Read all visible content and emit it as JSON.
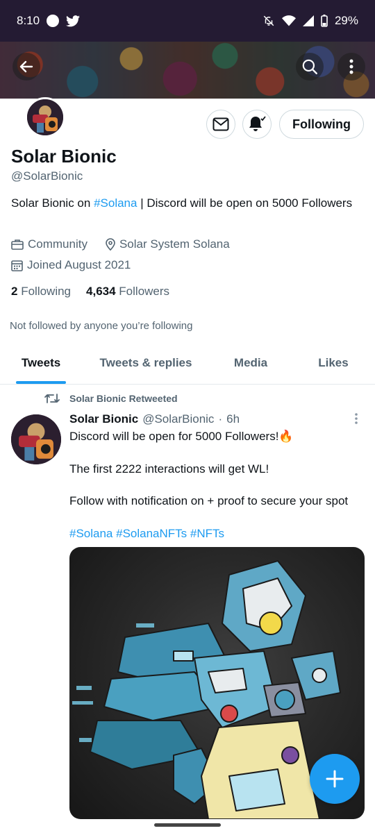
{
  "status_bar": {
    "time": "8:10",
    "battery": "29%",
    "icons": [
      "circle-dot-icon",
      "twitter-bird-icon",
      "mute-icon",
      "wifi-icon",
      "signal-icon",
      "battery-icon"
    ]
  },
  "header": {
    "back_icon": "back-arrow-icon",
    "search_icon": "search-icon",
    "more_icon": "more-vertical-icon"
  },
  "profile": {
    "display_name": "Solar Bionic",
    "handle": "@SolarBionic",
    "bio_prefix": "Solar Bionic on ",
    "bio_link": "#Solana",
    "bio_suffix": " | Discord will be open on 5000 Followers",
    "category": "Community",
    "location": "Solar System Solana",
    "joined": "Joined August 2021",
    "following_count": "2",
    "following_label": "Following",
    "followers_count": "4,634",
    "followers_label": "Followers",
    "not_followed_text": "Not followed by anyone you’re following",
    "following_button": "Following"
  },
  "tabs": [
    {
      "label": "Tweets",
      "active": true
    },
    {
      "label": "Tweets & replies",
      "active": false
    },
    {
      "label": "Media",
      "active": false
    },
    {
      "label": "Likes",
      "active": false
    }
  ],
  "tweet": {
    "retweet_label": "Solar Bionic Retweeted",
    "author_name": "Solar Bionic",
    "author_handle": "@SolarBionic",
    "separator": "·",
    "time": "6h",
    "line1": "Discord will be open for 5000 Followers!🔥",
    "line2": "The first 2222 interactions will get WL!",
    "line3": "Follow with notification on + proof to secure your spot",
    "hashtags": "#Solana #SolanaNFTs #NFTs"
  },
  "colors": {
    "accent": "#1d9bf0",
    "text": "#0f1419",
    "secondary_text": "#536471",
    "status_bar_bg": "#241b33"
  }
}
